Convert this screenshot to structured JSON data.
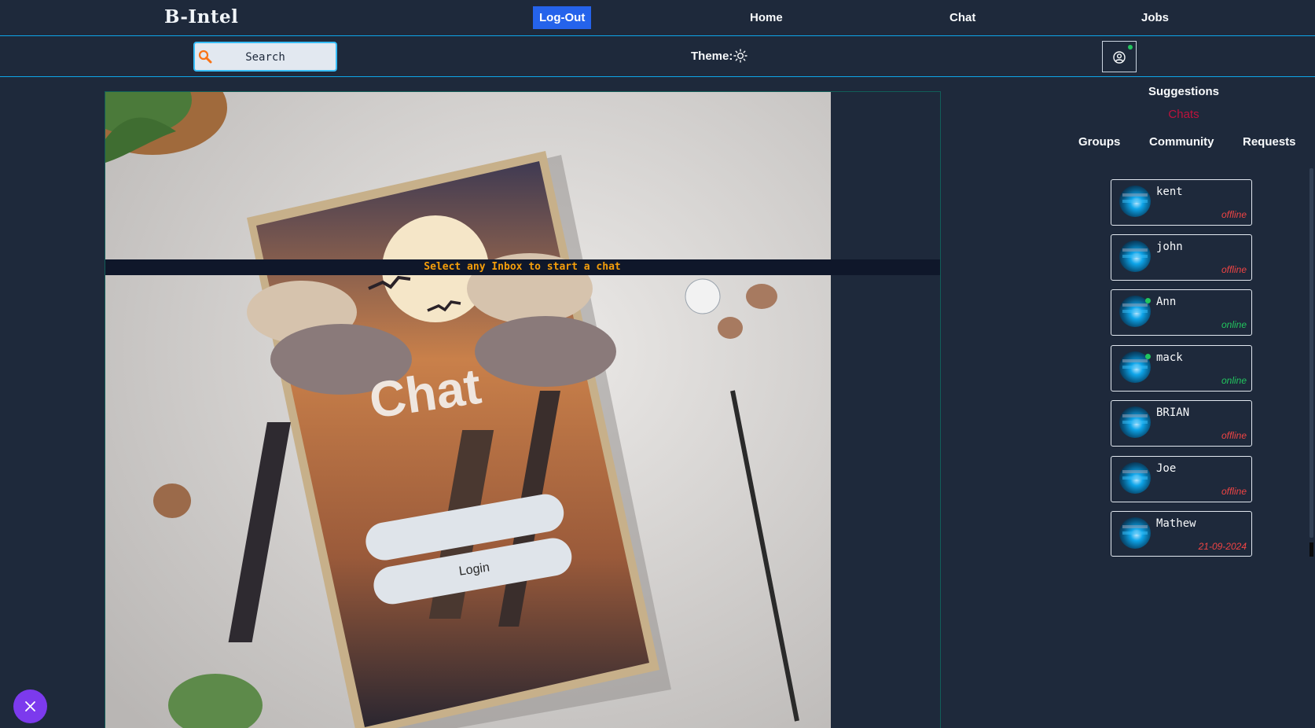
{
  "header": {
    "brand": "B-Intel",
    "logout_label": "Log-Out",
    "nav": [
      "Home",
      "Chat",
      "Jobs"
    ]
  },
  "toolbar": {
    "search_label": "Search",
    "theme_label": "Theme:",
    "theme_icon": "sun-icon",
    "profile_icon": "user-circle-icon",
    "profile_online": true
  },
  "chat": {
    "empty_prompt": "Select any Inbox to start a chat",
    "hero_title": "Chat",
    "hero_button": "Login"
  },
  "sidebar": {
    "heading": "Suggestions",
    "active_section": "Chats",
    "tabs": [
      "Groups",
      "Community",
      "Requests"
    ],
    "contacts": [
      {
        "name": "kent",
        "status": "offline",
        "online": false
      },
      {
        "name": "john",
        "status": "offline",
        "online": false
      },
      {
        "name": "Ann",
        "status": "online",
        "online": true
      },
      {
        "name": "mack",
        "status": "online",
        "online": true
      },
      {
        "name": "BRIAN",
        "status": "offline",
        "online": false
      },
      {
        "name": "Joe",
        "status": "offline",
        "online": false
      },
      {
        "name": "Mathew",
        "status": "21-09-2024",
        "online": false
      }
    ]
  },
  "colors": {
    "background": "#1e293b",
    "accent": "#2563eb",
    "divider": "#0ea5e9",
    "prompt": "#f59e0b",
    "offline": "#ef4444",
    "online": "#22c55e",
    "fab": "#7c3aed"
  }
}
